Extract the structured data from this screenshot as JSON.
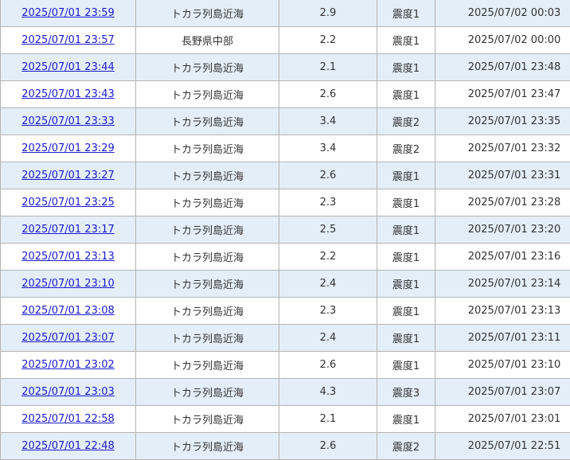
{
  "earthquake_rows": [
    {
      "time": "2025/07/01 23:59",
      "region": "トカラ列島近海",
      "magnitude": "2.9",
      "intensity": "震度1",
      "published": "2025/07/02 00:03"
    },
    {
      "time": "2025/07/01 23:57",
      "region": "長野県中部",
      "magnitude": "2.2",
      "intensity": "震度1",
      "published": "2025/07/02 00:00"
    },
    {
      "time": "2025/07/01 23:44",
      "region": "トカラ列島近海",
      "magnitude": "2.1",
      "intensity": "震度1",
      "published": "2025/07/01 23:48"
    },
    {
      "time": "2025/07/01 23:43",
      "region": "トカラ列島近海",
      "magnitude": "2.6",
      "intensity": "震度1",
      "published": "2025/07/01 23:47"
    },
    {
      "time": "2025/07/01 23:33",
      "region": "トカラ列島近海",
      "magnitude": "3.4",
      "intensity": "震度2",
      "published": "2025/07/01 23:35"
    },
    {
      "time": "2025/07/01 23:29",
      "region": "トカラ列島近海",
      "magnitude": "3.4",
      "intensity": "震度2",
      "published": "2025/07/01 23:32"
    },
    {
      "time": "2025/07/01 23:27",
      "region": "トカラ列島近海",
      "magnitude": "2.6",
      "intensity": "震度1",
      "published": "2025/07/01 23:31"
    },
    {
      "time": "2025/07/01 23:25",
      "region": "トカラ列島近海",
      "magnitude": "2.3",
      "intensity": "震度1",
      "published": "2025/07/01 23:28"
    },
    {
      "time": "2025/07/01 23:17",
      "region": "トカラ列島近海",
      "magnitude": "2.5",
      "intensity": "震度1",
      "published": "2025/07/01 23:20"
    },
    {
      "time": "2025/07/01 23:13",
      "region": "トカラ列島近海",
      "magnitude": "2.2",
      "intensity": "震度1",
      "published": "2025/07/01 23:16"
    },
    {
      "time": "2025/07/01 23:10",
      "region": "トカラ列島近海",
      "magnitude": "2.4",
      "intensity": "震度1",
      "published": "2025/07/01 23:14"
    },
    {
      "time": "2025/07/01 23:08",
      "region": "トカラ列島近海",
      "magnitude": "2.3",
      "intensity": "震度1",
      "published": "2025/07/01 23:13"
    },
    {
      "time": "2025/07/01 23:07",
      "region": "トカラ列島近海",
      "magnitude": "2.4",
      "intensity": "震度1",
      "published": "2025/07/01 23:11"
    },
    {
      "time": "2025/07/01 23:02",
      "region": "トカラ列島近海",
      "magnitude": "2.6",
      "intensity": "震度1",
      "published": "2025/07/01 23:10"
    },
    {
      "time": "2025/07/01 23:03",
      "region": "トカラ列島近海",
      "magnitude": "4.3",
      "intensity": "震度3",
      "published": "2025/07/01 23:07"
    },
    {
      "time": "2025/07/01 22:58",
      "region": "トカラ列島近海",
      "magnitude": "2.1",
      "intensity": "震度1",
      "published": "2025/07/01 23:01"
    },
    {
      "time": "2025/07/01 22:48",
      "region": "トカラ列島近海",
      "magnitude": "2.6",
      "intensity": "震度2",
      "published": "2025/07/01 22:51"
    }
  ],
  "colors": {
    "link": "#1a1ad2",
    "row_alt": "#e4eef8",
    "border": "#b4b4b4"
  }
}
